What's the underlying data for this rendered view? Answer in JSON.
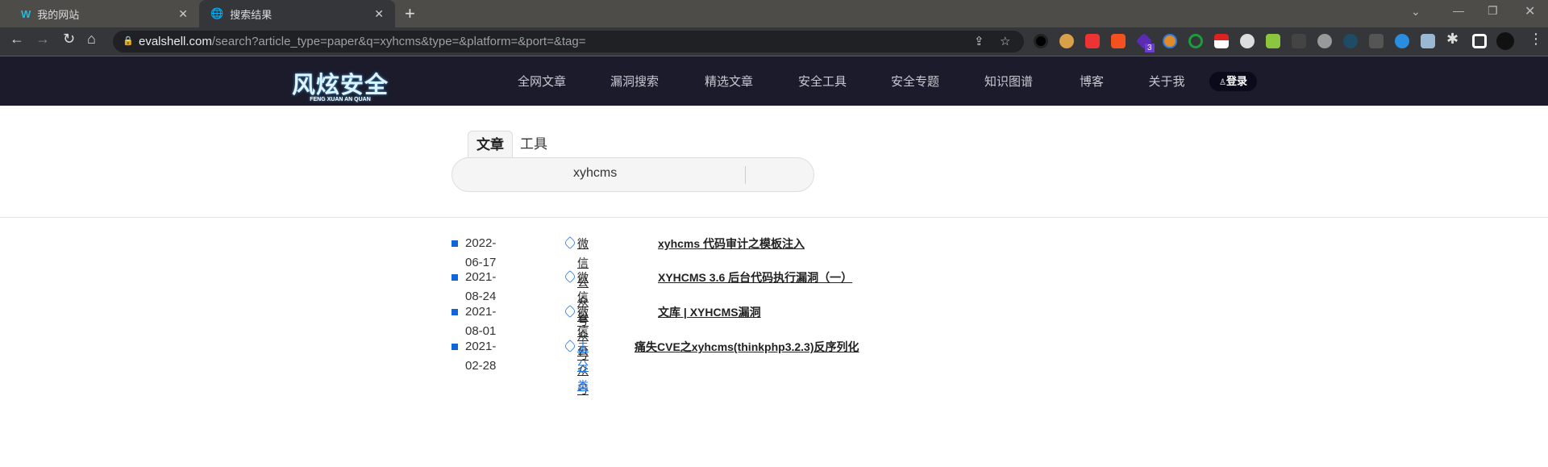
{
  "browser": {
    "tabs": [
      {
        "title": "我的网站"
      },
      {
        "title": "搜索结果"
      }
    ],
    "new_tab": "+",
    "close": "✕",
    "url_host": "evalshell.com",
    "url_path": "/search?article_type=paper&q=xyhcms&type=&platform=&port=&tag=",
    "badge": "3"
  },
  "site": {
    "logo": "风炫安全",
    "logo_sub": "FENG XUAN AN QUAN",
    "nav": [
      "全网文章",
      "漏洞搜索",
      "精选文章",
      "安全工具",
      "安全专题",
      "知识图谱",
      "博客",
      "关于我"
    ],
    "login": "登录"
  },
  "search": {
    "tabs": [
      "文章",
      "工具"
    ],
    "query": "xyhcms"
  },
  "results": [
    {
      "date": "2022-06-17",
      "tag": "微信公众号",
      "title": "xyhcms 代码审计之模板注入"
    },
    {
      "date": "2021-08-24",
      "tag": "微信公众号",
      "title": "XYHCMS 3.6 后台代码执行漏洞（一）"
    },
    {
      "date": "2021-08-01",
      "tag": "微信公众号",
      "title": "文库 | XYHCMS漏洞"
    },
    {
      "date": "2021-02-28",
      "tag": "未分类",
      "title": "痛失CVE之xyhcms(thinkphp3.2.3)反序列化"
    }
  ],
  "colors": {
    "accent": "#1a73e8",
    "nav_bg": "#1c1b2b"
  }
}
